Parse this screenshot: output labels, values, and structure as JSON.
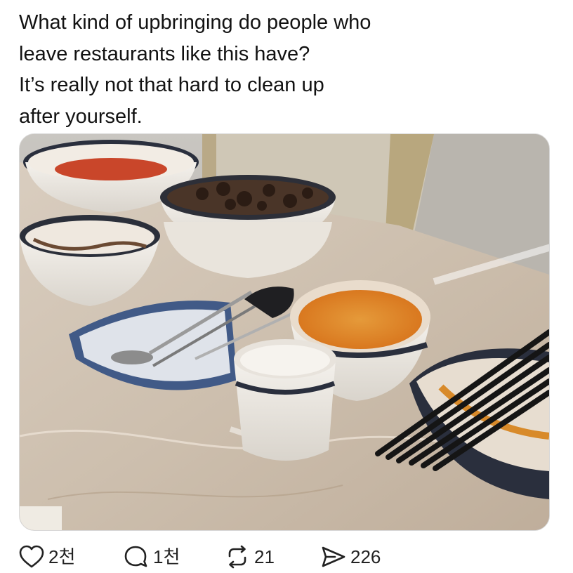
{
  "post": {
    "lines": [
      "What kind of upbringing do people who",
      "leave restaurants like this have?",
      "It’s really not that hard to clean up",
      "after yourself."
    ]
  },
  "actions": {
    "like": {
      "icon": "heart-icon",
      "count": "2천"
    },
    "reply": {
      "icon": "comment-icon",
      "count": "1천"
    },
    "repost": {
      "icon": "repost-icon",
      "count": "21"
    },
    "share": {
      "icon": "send-icon",
      "count": "226"
    }
  },
  "colors": {
    "text": "#121212",
    "icon": "#222222",
    "background": "#ffffff"
  }
}
